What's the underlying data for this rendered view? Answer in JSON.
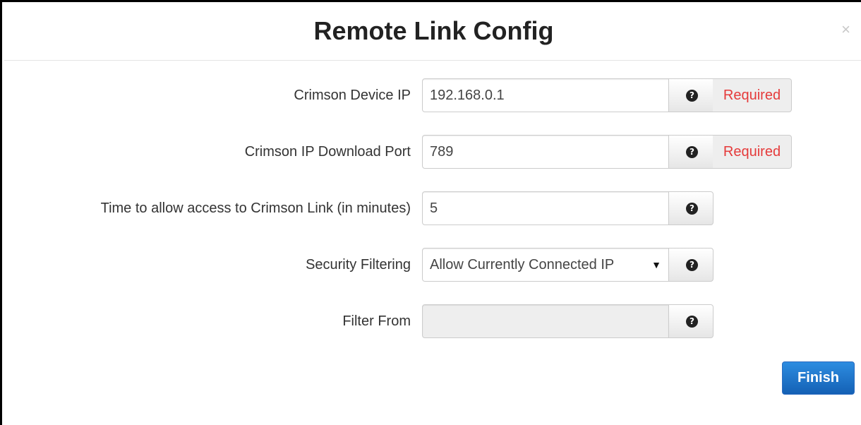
{
  "modal": {
    "title": "Remote Link Config",
    "close_label": "×"
  },
  "form": {
    "device_ip": {
      "label": "Crimson Device IP",
      "value": "192.168.0.1",
      "status": "Required"
    },
    "download_port": {
      "label": "Crimson IP Download Port",
      "value": "789",
      "status": "Required"
    },
    "access_time": {
      "label": "Time to allow access to Crimson Link (in minutes)",
      "value": "5"
    },
    "security_filtering": {
      "label": "Security Filtering",
      "selected": "Allow Currently Connected IP",
      "arrow": "▼"
    },
    "filter_from": {
      "label": "Filter From",
      "value": ""
    },
    "help_icon_glyph": "?"
  },
  "footer": {
    "finish_label": "Finish"
  },
  "colors": {
    "required_text": "#e53b3b",
    "primary_button": "#1f74cc"
  },
  "icons": {
    "help": "question-circle-icon",
    "close": "close-icon",
    "dropdown": "caret-down-icon"
  }
}
